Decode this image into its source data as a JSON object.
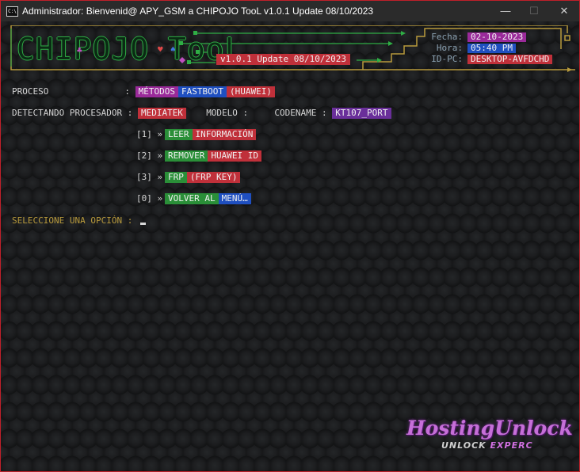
{
  "window": {
    "title": "Administrador:  Bienvenid@ APY_GSM a CHIPOJO TooL v1.0.1 Update 08/10/2023",
    "icon_label": "C:\\",
    "buttons": {
      "minimize": "—",
      "maximize": "☐",
      "close": "✕"
    }
  },
  "banner": {
    "logo": "CHIPOJO TooL",
    "suit_club": "♣",
    "suit_heart": "♥",
    "suit_spade": "♠",
    "version": "v1.0.1 Update 08/10/2023",
    "fecha_label": "Fecha:",
    "fecha_value": "02-10-2023",
    "hora_label": "Hora:",
    "hora_value": "05:40 PM",
    "idpc_label": "ID-PC:",
    "idpc_value": "DESKTOP-AVFDCHD"
  },
  "proceso": {
    "label": "PROCESO",
    "separator": ":",
    "metodos": "MÉTODOS",
    "fastboot": "FASTBOOT",
    "huawei": "(HUAWEI)"
  },
  "detect": {
    "label": "DETECTANDO PROCESADOR :",
    "processor": "MEDIATEK",
    "model_label": "MODELO :",
    "model_value": "",
    "codename_label": "CODENAME :",
    "codename_value": "KT107_PORT"
  },
  "options": [
    {
      "num": "[1] »",
      "a": "LEER",
      "b": "INFORMACIÓN"
    },
    {
      "num": "[2] »",
      "a": "REMOVER",
      "b": "HUAWEI ID"
    },
    {
      "num": "[3] »",
      "a": "FRP",
      "b": "(FRP KEY)"
    },
    {
      "num": "[0] »",
      "a": "VOLVER AL",
      "b": "MENÚ…"
    }
  ],
  "prompt": "SELECCIONE UNA OPCIÓN :",
  "watermark": {
    "brand": "HostingUnlock",
    "sub_1": "UNLOCK",
    "sub_2": "EXPERC"
  },
  "colors": {
    "accent_green": "#2fae45",
    "accent_gold": "#b89a3c",
    "badge_red": "#c0303a",
    "badge_purple": "#9a2a9a",
    "badge_blue": "#1f4fc0",
    "badge_green": "#2a8f38"
  }
}
